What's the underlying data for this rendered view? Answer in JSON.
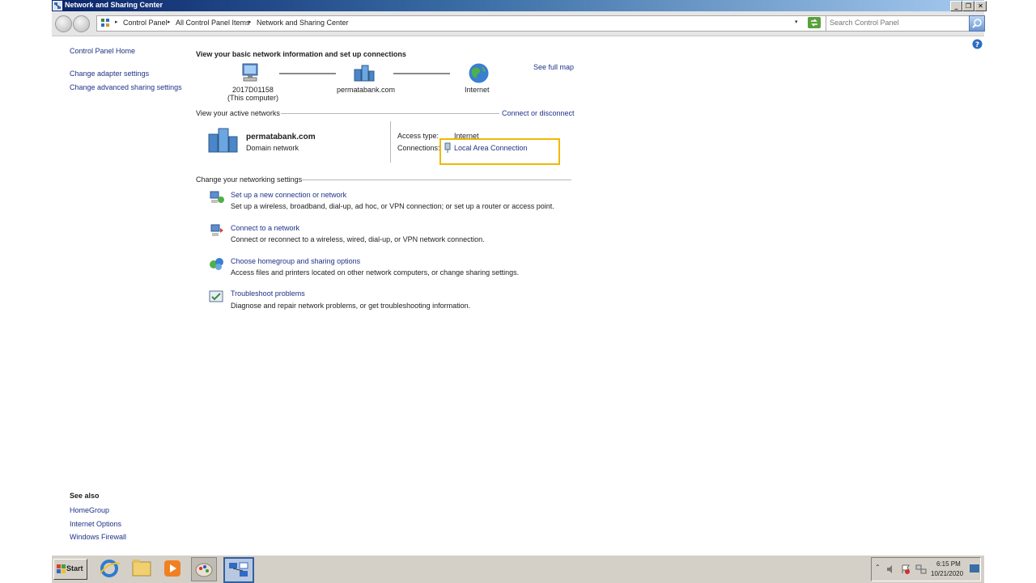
{
  "window": {
    "title": "Network and Sharing Center",
    "buttons": [
      "_",
      "❐",
      "✕"
    ]
  },
  "address_bar": {
    "crumbs": [
      "Control Panel",
      "All Control Panel Items",
      "Network and Sharing Center"
    ],
    "search_placeholder": "Search Control Panel"
  },
  "sidebar": {
    "home": "Control Panel Home",
    "links": [
      "Change adapter settings",
      "Change advanced sharing settings"
    ],
    "see_also_title": "See also",
    "see_also": [
      "HomeGroup",
      "Internet Options",
      "Windows Firewall"
    ]
  },
  "main": {
    "heading": "View your basic network information and set up connections",
    "see_full_map": "See full map",
    "map": {
      "computer_name": "2017D01158",
      "computer_sub": "(This computer)",
      "network_name": "permatabank.com",
      "internet": "Internet"
    },
    "active_networks_title": "View your active networks",
    "connect_or_disconnect": "Connect or disconnect",
    "active_network": {
      "name": "permatabank.com",
      "type": "Domain network",
      "access_type_label": "Access type:",
      "access_type_value": "Internet",
      "connections_label": "Connections:",
      "connection_value": "Local Area Connection"
    },
    "change_settings_title": "Change your networking settings",
    "tasks": [
      {
        "title": "Set up a new connection or network",
        "desc": "Set up a wireless, broadband, dial-up, ad hoc, or VPN connection; or set up a router or access point.",
        "icon": "setup-connection-icon"
      },
      {
        "title": "Connect to a network",
        "desc": "Connect or reconnect to a wireless, wired, dial-up, or VPN network connection.",
        "icon": "connect-network-icon"
      },
      {
        "title": "Choose homegroup and sharing options",
        "desc": "Access files and printers located on other network computers, or change sharing settings.",
        "icon": "homegroup-icon"
      },
      {
        "title": "Troubleshoot problems",
        "desc": "Diagnose and repair network problems, or get troubleshooting information.",
        "icon": "troubleshoot-icon"
      }
    ]
  },
  "taskbar": {
    "start": "Start",
    "time": "6:15 PM",
    "date": "10/21/2020"
  },
  "colors": {
    "link": "#1e3287",
    "highlight": "#f0b800",
    "titlebar_start": "#0a246a"
  }
}
